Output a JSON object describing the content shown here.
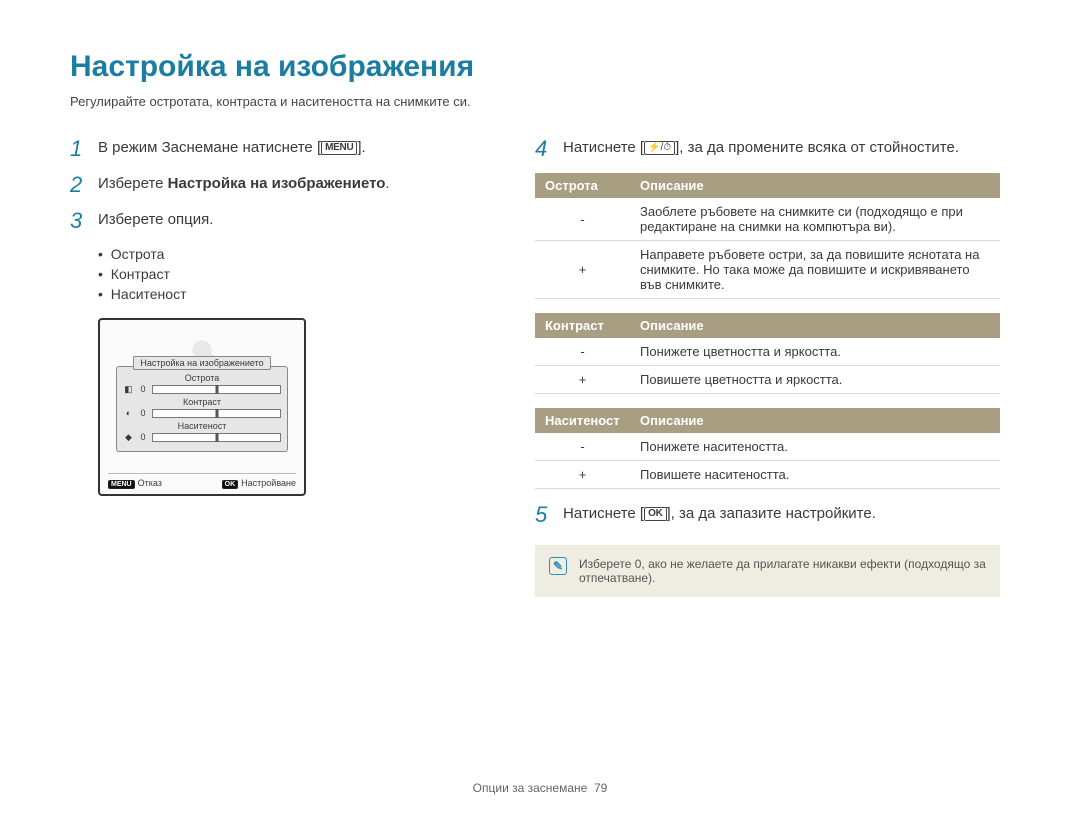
{
  "title": "Настройка на изображения",
  "subtitle": "Регулирайте остротата, контраста и наситеността на снимките си.",
  "steps": {
    "s1": {
      "num": "1",
      "text_before": "В режим Заснемане натиснете [",
      "icon": "MENU",
      "text_after": "]."
    },
    "s2": {
      "num": "2",
      "text_before": "Изберете ",
      "bold": "Настройка на изображението",
      "text_after": "."
    },
    "s3": {
      "num": "3",
      "text": "Изберете опция."
    },
    "s3_bullets": [
      "Острота",
      "Контраст",
      "Наситеност"
    ],
    "s4": {
      "num": "4",
      "text_before": "Натиснете [",
      "icon_pair": "⚡/⏱",
      "text_after": "], за да промените всяка от стойностите."
    },
    "s5": {
      "num": "5",
      "text_before": "Натиснете [",
      "icon": "OK",
      "text_after": "], за да запазите настройките."
    }
  },
  "lcd": {
    "panel_title": "Настройка на изображението",
    "rows": [
      {
        "icon": "◧",
        "label": "Острота",
        "val": "0"
      },
      {
        "icon": "◐",
        "label": "Контраст",
        "val": "0"
      },
      {
        "icon": "◆",
        "label": "Наситеност",
        "val": "0"
      }
    ],
    "footer_left_btn": "MENU",
    "footer_left_label": "Отказ",
    "footer_right_btn": "OK",
    "footer_right_label": "Настройване"
  },
  "tables": {
    "sharpness": {
      "header_a": "Острота",
      "header_b": "Описание",
      "rows": [
        {
          "a": "-",
          "b": "Заоблете ръбовете на снимките си (подходящо е при редактиране на снимки на компютъра ви)."
        },
        {
          "a": "+",
          "b": "Направете ръбовете остри, за да повишите яснотата на снимките. Но така може да повишите и искривяването във снимките."
        }
      ]
    },
    "contrast": {
      "header_a": "Контраст",
      "header_b": "Описание",
      "rows": [
        {
          "a": "-",
          "b": "Понижете цветността и яркостта."
        },
        {
          "a": "+",
          "b": "Повишете цветността и яркостта."
        }
      ]
    },
    "saturation": {
      "header_a": "Наситеност",
      "header_b": "Описание",
      "rows": [
        {
          "a": "-",
          "b": "Понижете наситеността."
        },
        {
          "a": "+",
          "b": "Повишете наситеността."
        }
      ]
    }
  },
  "note": "Изберете 0, ако не желаете да прилагате никакви ефекти (подходящо за отпечатване).",
  "footer_label": "Опции за заснемане",
  "footer_page": "79"
}
